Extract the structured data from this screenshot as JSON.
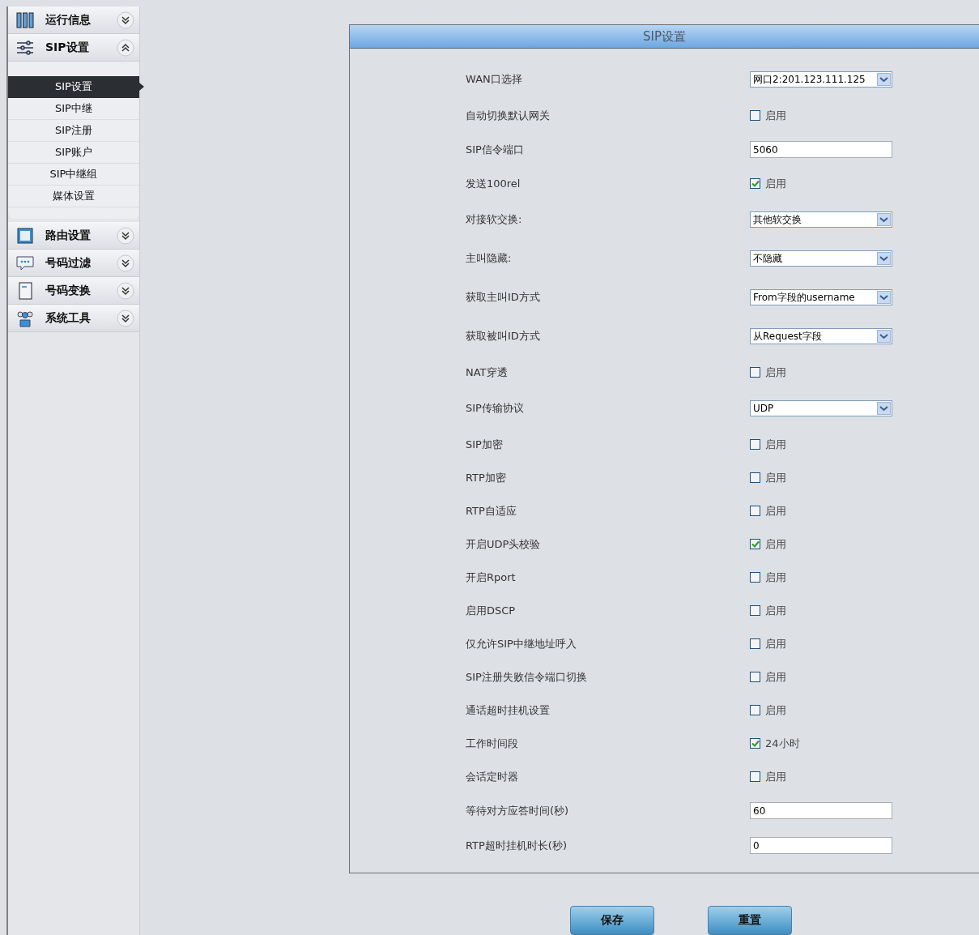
{
  "sidebar": {
    "groups": [
      {
        "label": "运行信息",
        "kind": "bars",
        "expanded": false
      },
      {
        "label": "SIP设置",
        "kind": "sliders",
        "expanded": true,
        "items": [
          {
            "label": "SIP设置",
            "selected": true
          },
          {
            "label": "SIP中继",
            "selected": false
          },
          {
            "label": "SIP注册",
            "selected": false
          },
          {
            "label": "SIP账户",
            "selected": false
          },
          {
            "label": "SIP中继组",
            "selected": false
          },
          {
            "label": "媒体设置",
            "selected": false
          }
        ]
      },
      {
        "label": "路由设置",
        "kind": "square",
        "expanded": false
      },
      {
        "label": "号码过滤",
        "kind": "chat",
        "expanded": false
      },
      {
        "label": "号码变换",
        "kind": "book",
        "expanded": false
      },
      {
        "label": "系统工具",
        "kind": "people",
        "expanded": false
      }
    ]
  },
  "panel": {
    "title": "SIP设置",
    "rows": [
      {
        "kind": "select",
        "label": "WAN口选择",
        "value": "网口2:201.123.111.125"
      },
      {
        "kind": "checkbox",
        "label": "自动切换默认网关",
        "checked": false,
        "option": "启用"
      },
      {
        "kind": "text",
        "label": "SIP信令端口",
        "value": "5060"
      },
      {
        "kind": "checkbox",
        "label": "发送100rel",
        "checked": true,
        "option": "启用"
      },
      {
        "kind": "select",
        "label": "对接软交换:",
        "value": "其他软交换"
      },
      {
        "kind": "select",
        "label": "主叫隐藏:",
        "value": "不隐藏"
      },
      {
        "kind": "select",
        "label": "获取主叫ID方式",
        "value": "From字段的username"
      },
      {
        "kind": "select",
        "label": "获取被叫ID方式",
        "value": "从Request字段"
      },
      {
        "kind": "checkbox",
        "label": "NAT穿透",
        "checked": false,
        "option": "启用"
      },
      {
        "kind": "select",
        "label": "SIP传输协议",
        "value": "UDP"
      },
      {
        "kind": "checkbox",
        "label": "SIP加密",
        "checked": false,
        "option": "启用"
      },
      {
        "kind": "checkbox",
        "label": "RTP加密",
        "checked": false,
        "option": "启用"
      },
      {
        "kind": "checkbox",
        "label": "RTP自适应",
        "checked": false,
        "option": "启用"
      },
      {
        "kind": "checkbox",
        "label": "开启UDP头校验",
        "checked": true,
        "option": "启用"
      },
      {
        "kind": "checkbox",
        "label": "开启Rport",
        "checked": false,
        "option": "启用"
      },
      {
        "kind": "checkbox",
        "label": "启用DSCP",
        "checked": false,
        "option": "启用"
      },
      {
        "kind": "checkbox",
        "label": "仅允许SIP中继地址呼入",
        "checked": false,
        "option": "启用"
      },
      {
        "kind": "checkbox",
        "label": "SIP注册失败信令端口切换",
        "checked": false,
        "option": "启用"
      },
      {
        "kind": "checkbox",
        "label": "通话超时挂机设置",
        "checked": false,
        "option": "启用"
      },
      {
        "kind": "checkbox",
        "label": "工作时间段",
        "checked": true,
        "option": "24小时"
      },
      {
        "kind": "checkbox",
        "label": "会话定时器",
        "checked": false,
        "option": "启用"
      },
      {
        "kind": "text",
        "label": "等待对方应答时间(秒)",
        "value": "60"
      },
      {
        "kind": "text",
        "label": "RTP超时挂机时长(秒)",
        "value": "0"
      }
    ]
  },
  "buttons": [
    "保存",
    "重置"
  ]
}
